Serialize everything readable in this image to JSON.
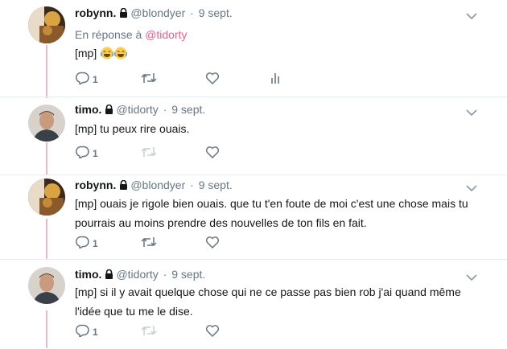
{
  "tweets": [
    {
      "author_name": "robynn.",
      "handle": "@blondyer",
      "separator": "·",
      "date": "9 sept.",
      "reply_prefix": "En réponse à",
      "reply_handle": "@tidorty",
      "text": "[mp]",
      "emoji": [
        "face-with-tears-of-joy",
        "face-with-tears-of-joy"
      ],
      "reply_count": "1",
      "avatar": "robynn-avatar"
    },
    {
      "author_name": "timo.",
      "handle": "@tidorty",
      "separator": "·",
      "date": "9 sept.",
      "text": "[mp] tu peux rire ouais.",
      "reply_count": "1",
      "avatar": "timo-avatar"
    },
    {
      "author_name": "robynn.",
      "handle": "@blondyer",
      "separator": "·",
      "date": "9 sept.",
      "text_line1": "[mp] ouais je rigole bien ouais. que tu t'en foute de moi c'est une chose mais tu",
      "text_line2": "pourrais au moins prendre des nouvelles de ton fils en fait.",
      "reply_count": "1",
      "avatar": "robynn-avatar"
    },
    {
      "author_name": "timo.",
      "handle": "@tidorty",
      "separator": "·",
      "date": "9 sept.",
      "text_line1": "[mp] si il y avait quelque chose qui ne ce passe pas bien rob j'ai quand même",
      "text_line2": "l'idée que tu me le dise.",
      "reply_count": "1",
      "avatar": "timo-avatar"
    }
  ],
  "colors": {
    "thread_line": "#f7b5c9",
    "reply_handle": "#f45d8c",
    "muted": "#657786"
  }
}
